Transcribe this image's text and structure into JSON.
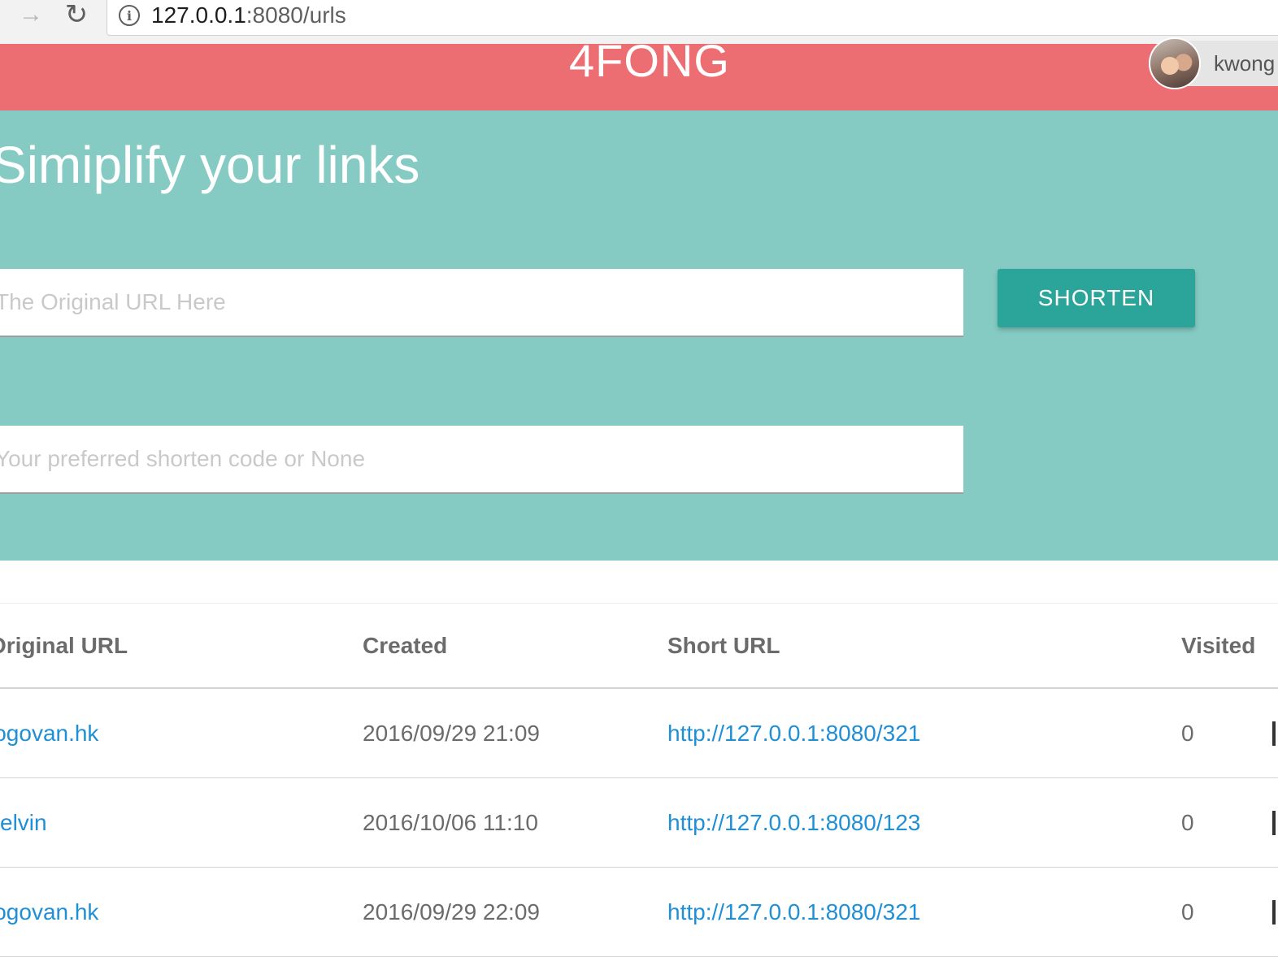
{
  "browser": {
    "forward_icon": "arrow-right-icon",
    "reload_icon": "reload-icon",
    "url_host": "127.0.0.1",
    "url_path": ":8080/urls"
  },
  "header": {
    "brand": "4FONG",
    "username": "kwong",
    "background": "#ec6e73"
  },
  "hero": {
    "title": "Simiplify your links",
    "background": "#85cbc3",
    "url_placeholder": "The Original URL Here",
    "code_placeholder": "Your preferred shorten code or None",
    "shorten_label": "SHORTEN",
    "button_color": "#2ba599"
  },
  "table": {
    "headers": {
      "original": "Original URL",
      "created": "Created",
      "short": "Short URL",
      "visited": "Visited"
    },
    "rows": [
      {
        "original": "logovan.hk",
        "created": "2016/09/29 21:09",
        "short": "http://127.0.0.1:8080/321",
        "visited": "0"
      },
      {
        "original": "kelvin",
        "created": "2016/10/06 11:10",
        "short": "http://127.0.0.1:8080/123",
        "visited": "0"
      },
      {
        "original": "logovan.hk",
        "created": "2016/09/29 22:09",
        "short": "http://127.0.0.1:8080/321",
        "visited": "0"
      }
    ],
    "link_color": "#1f8fd6"
  }
}
